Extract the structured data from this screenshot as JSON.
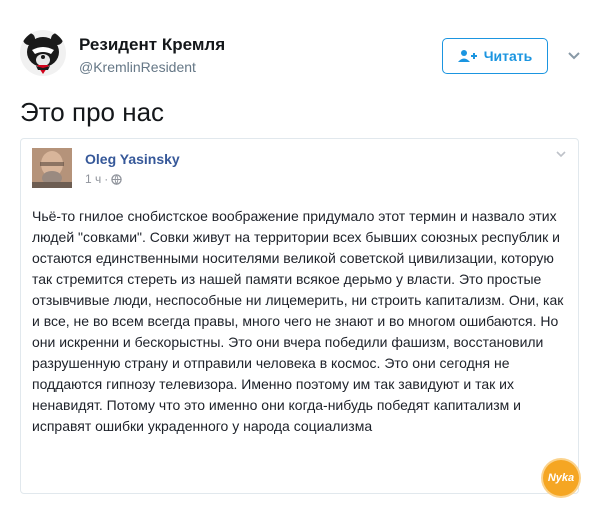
{
  "author": {
    "name": "Резидент Кремля",
    "handle": "@KremlinResident",
    "avatar_icon": "bear-mask-icon"
  },
  "follow_button": {
    "label": "Читать",
    "icon": "add-user-icon"
  },
  "tweet": {
    "text": "Это про нас"
  },
  "quoted_post": {
    "author_name": "Oleg Yasinsky",
    "time": "1 ч",
    "separator": "·",
    "privacy_icon": "globe-icon",
    "body": "Чьё-то гнилое снобистское воображение придумало этот термин и назвало этих людей \"совками\". Совки живут на территории всех бывших союзных республик и остаются единственными носителями великой советской цивилизации, которую так стремится стереть из нашей памяти всякое дерьмо у власти. Это простые отзывчивые люди, неспособные ни лицемерить, ни строить капитализм. Они, как и все, не во всем всегда правы, много чего не знают и во многом ошибаются. Но они искренни и бескорыстны. Это они вчера победили фашизм, восстановили разрушенную страну и отправили человека в космос. Это они сегодня не поддаются гипнозу телевизора. Именно поэтому им так завидуют и так их ненавидят. Потому что это именно они когда-нибудь победят капитализм и исправят ошибки украденного у народа социализма"
  },
  "watermark": {
    "text": "Nyka",
    "color": "#f5a623"
  },
  "colors": {
    "accent": "#1b95e0",
    "fb_name": "#365899",
    "muted": "#657786"
  }
}
